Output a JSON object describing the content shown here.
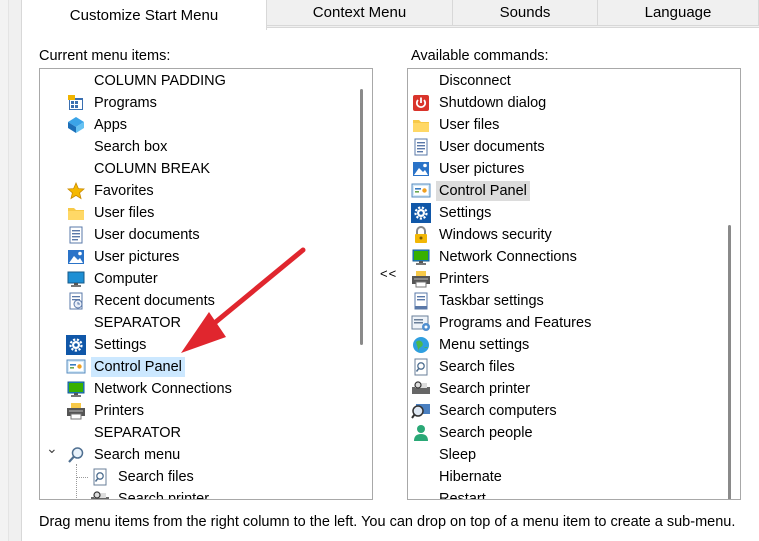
{
  "tabs": [
    {
      "label": "Customize Start Menu",
      "active": true
    },
    {
      "label": "Context Menu"
    },
    {
      "label": "Sounds"
    },
    {
      "label": "Language"
    }
  ],
  "left_panel": {
    "label": "Current menu items:",
    "items": [
      {
        "label": "COLUMN PADDING",
        "icon": "none"
      },
      {
        "label": "Programs",
        "icon": "programs-icon"
      },
      {
        "label": "Apps",
        "icon": "apps-icon"
      },
      {
        "label": "Search box",
        "icon": "none"
      },
      {
        "label": "COLUMN BREAK",
        "icon": "none"
      },
      {
        "label": "Favorites",
        "icon": "star-icon"
      },
      {
        "label": "User files",
        "icon": "folder-icon"
      },
      {
        "label": "User documents",
        "icon": "document-icon"
      },
      {
        "label": "User pictures",
        "icon": "picture-icon"
      },
      {
        "label": "Computer",
        "icon": "computer-icon"
      },
      {
        "label": "Recent documents",
        "icon": "recent-documents-icon"
      },
      {
        "label": "SEPARATOR",
        "icon": "none"
      },
      {
        "label": "Settings",
        "icon": "gear-icon"
      },
      {
        "label": "Control Panel",
        "icon": "control-panel-icon",
        "highlighted": true
      },
      {
        "label": "Network Connections",
        "icon": "network-icon"
      },
      {
        "label": "Printers",
        "icon": "printer-icon"
      },
      {
        "label": "SEPARATOR",
        "icon": "none"
      },
      {
        "label": "Search menu",
        "icon": "magnifier-icon",
        "expander": "⌄"
      },
      {
        "label": "Search files",
        "icon": "search-file-icon",
        "child": true
      },
      {
        "label": "Search printer",
        "icon": "search-printer-icon",
        "child": true
      }
    ]
  },
  "right_panel": {
    "label": "Available commands:",
    "items": [
      {
        "label": "Disconnect",
        "icon": "none"
      },
      {
        "label": "Shutdown dialog",
        "icon": "power-icon"
      },
      {
        "label": "User files",
        "icon": "folder-icon"
      },
      {
        "label": "User documents",
        "icon": "document-icon"
      },
      {
        "label": "User pictures",
        "icon": "picture-icon"
      },
      {
        "label": "Control Panel",
        "icon": "control-panel-icon",
        "selected": true
      },
      {
        "label": "Settings",
        "icon": "gear-icon"
      },
      {
        "label": "Windows security",
        "icon": "lock-icon"
      },
      {
        "label": "Network Connections",
        "icon": "network-icon"
      },
      {
        "label": "Printers",
        "icon": "printer-icon"
      },
      {
        "label": "Taskbar settings",
        "icon": "taskbar-icon"
      },
      {
        "label": "Programs and Features",
        "icon": "programs-features-icon"
      },
      {
        "label": "Menu settings",
        "icon": "globe-icon"
      },
      {
        "label": "Search files",
        "icon": "search-file-icon"
      },
      {
        "label": "Search printer",
        "icon": "search-printer-icon"
      },
      {
        "label": "Search computers",
        "icon": "search-computers-icon"
      },
      {
        "label": "Search people",
        "icon": "people-icon"
      },
      {
        "label": "Sleep",
        "icon": "none"
      },
      {
        "label": "Hibernate",
        "icon": "none"
      },
      {
        "label": "Restart",
        "icon": "none"
      }
    ]
  },
  "move_button": "<<",
  "help_text": "Drag menu items from the right column to the left. You can drop on top of a menu item to create a sub-menu.",
  "colors": {
    "arrow": "#e0262e",
    "highlight": "#cce8ff",
    "selected": "#dcdcdc"
  }
}
